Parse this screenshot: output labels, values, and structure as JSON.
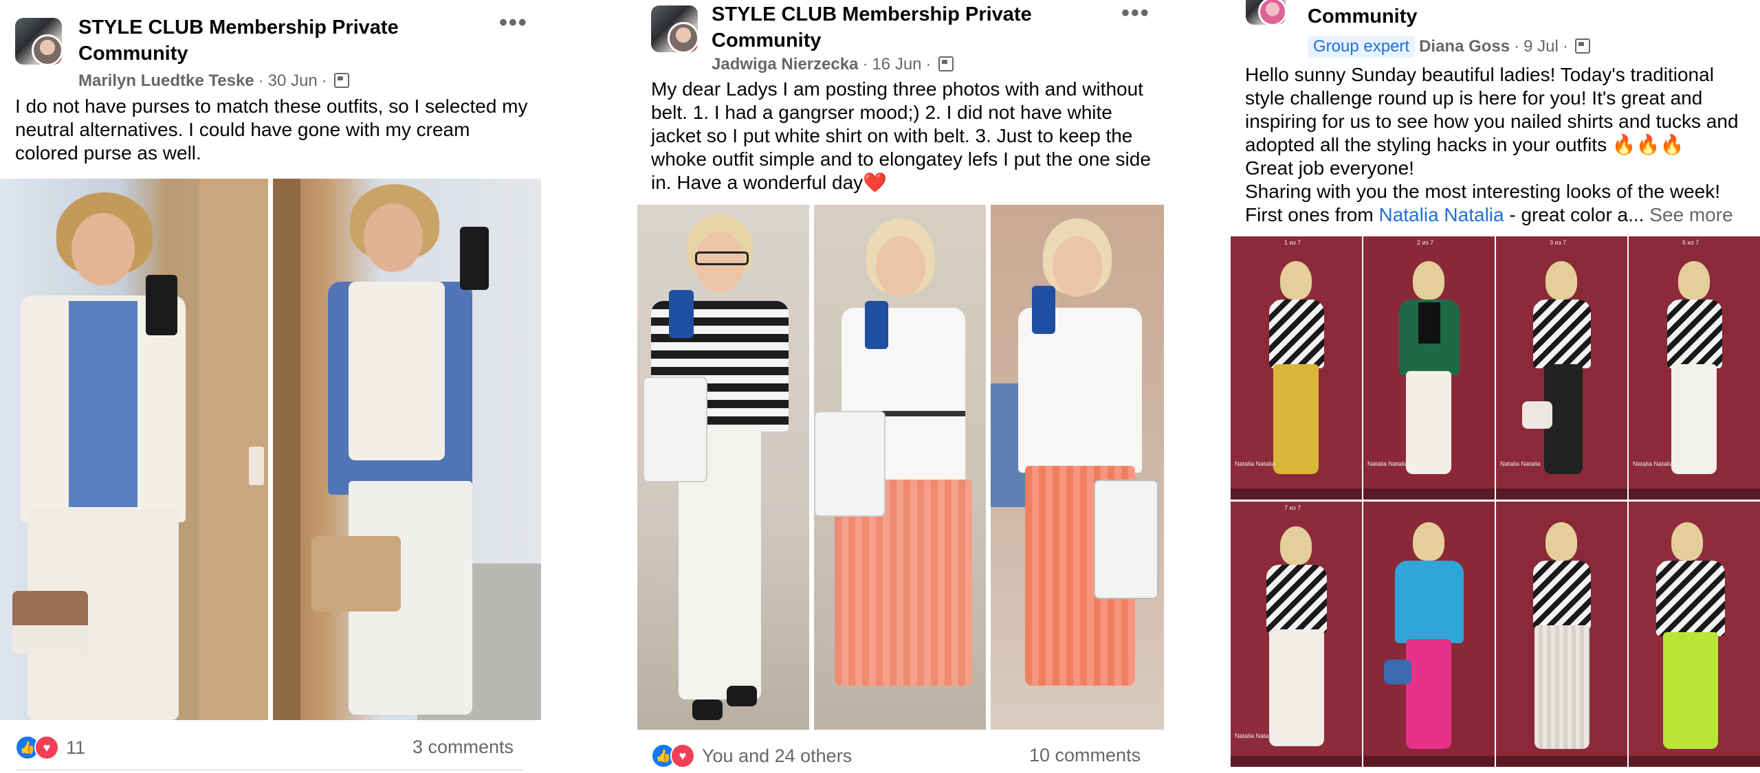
{
  "colors": {
    "accent": "#216fdb",
    "meta": "#65676b",
    "like": "#1877f2",
    "love": "#f33e58",
    "wine_wall": "#8c2a3a"
  },
  "posts": [
    {
      "group_name": "STYLE CLUB Membership Private Community",
      "author": "Marilyn Luedtke Teske",
      "date": "30 Jun",
      "text": "I do not have purses to match these outfits, so I selected my neutral alternatives.  I could have gone with my cream colored purse as well.",
      "reaction_count": "11",
      "comments": "3 comments",
      "icons": [
        "group-avatar",
        "privacy-members-icon",
        "more-options-icon",
        "like-reaction-icon",
        "love-reaction-icon"
      ]
    },
    {
      "group_name": "STYLE CLUB Membership Private Community",
      "author": "Jadwiga Nierzecka",
      "date": "16 Jun",
      "text": "My dear Ladys  I am posting three photos with and without belt. 1. I had a gangrser mood;) 2. I did not have white jacket so I put white shirt on with belt. 3. Just to keep the whoke outfit simple and to elongatey lefs I put the one side in. Have a wonderful day❤️",
      "reaction_summary": "You and 24 others",
      "comments": "10 comments"
    },
    {
      "group_name": "Community",
      "badge": "Group expert",
      "author": "Diana Goss",
      "date": "9 Jul",
      "text_line1": "Hello sunny Sunday beautiful ladies! Today's traditional style challenge round up is here for you! It's great and inspiring for us to see how you nailed shirts and tucks and adopted all the styling hacks in your outfits 🔥🔥🔥",
      "text_line2": "Great job everyone!",
      "text_line3a": "Sharing with you the most interesting looks of the week!",
      "text_line3b_prefix": "First ones from ",
      "mention": "Natalia Natalia",
      "text_line3b_suffix": " - great color a...",
      "see_more": "See more",
      "grid_cells": [
        {
          "counter": "1 из 7",
          "name": "Natalia Natalia"
        },
        {
          "counter": "2 из 7",
          "name": "Natalia Natalia"
        },
        {
          "counter": "3 из 7",
          "name": "Natalia Natalia"
        },
        {
          "counter": "6 из 7",
          "name": "Natalia Natalia"
        },
        {
          "counter": "7 из 7",
          "name": "Natalia Natalia"
        },
        {
          "counter": "",
          "name": ""
        },
        {
          "counter": "",
          "name": ""
        },
        {
          "counter": "",
          "name": ""
        }
      ]
    }
  ]
}
